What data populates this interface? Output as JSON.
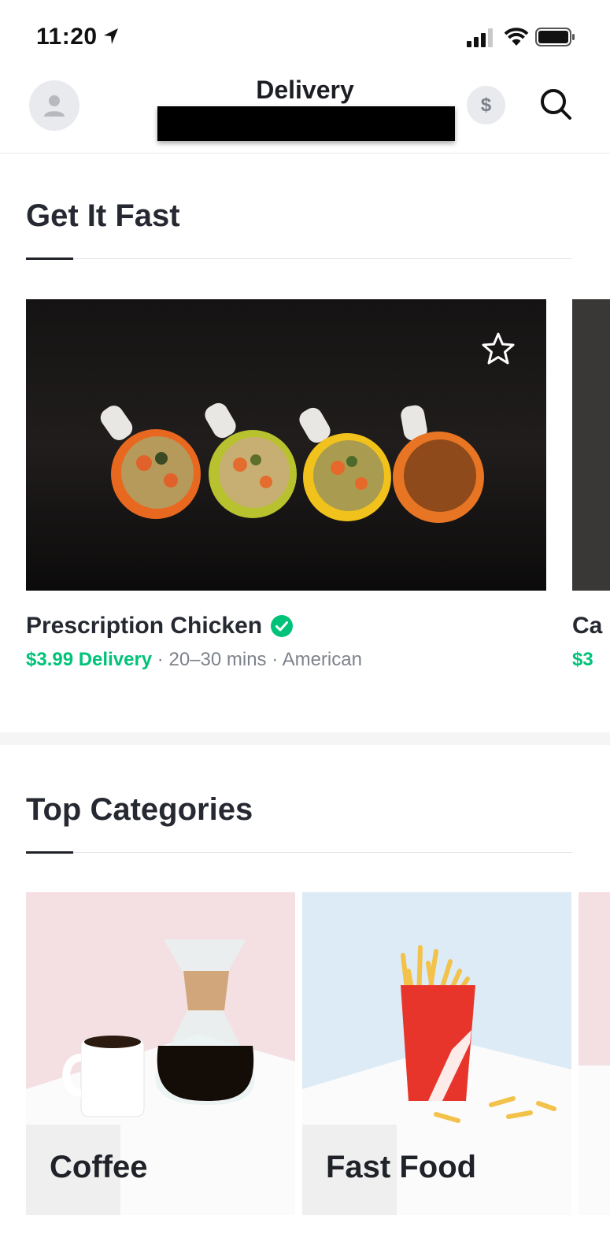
{
  "status_bar": {
    "time": "11:20",
    "icons": [
      "location-arrow-icon",
      "signal-icon",
      "wifi-icon",
      "battery-icon"
    ]
  },
  "header": {
    "title": "Delivery",
    "dollar_symbol": "$",
    "icons": [
      "avatar-icon",
      "dollar-icon",
      "search-icon"
    ]
  },
  "sections": {
    "get_it_fast": {
      "title": "Get It Fast",
      "store": {
        "name": "Prescription Chicken",
        "delivery_fee": "$3.99 Delivery",
        "eta": "20–30 mins",
        "cuisine": "American",
        "verified": true
      },
      "peek_store": {
        "name": "Ca",
        "fee": "$3"
      }
    },
    "top_categories": {
      "title": "Top Categories",
      "categories": [
        {
          "label": "Coffee"
        },
        {
          "label": "Fast Food"
        }
      ]
    }
  },
  "colors": {
    "accent_green": "#00c379",
    "heading": "#262931",
    "muted": "#7e828b",
    "coffee_bg": "#f4dfe2",
    "fastfood_bg": "#dcebf5"
  }
}
